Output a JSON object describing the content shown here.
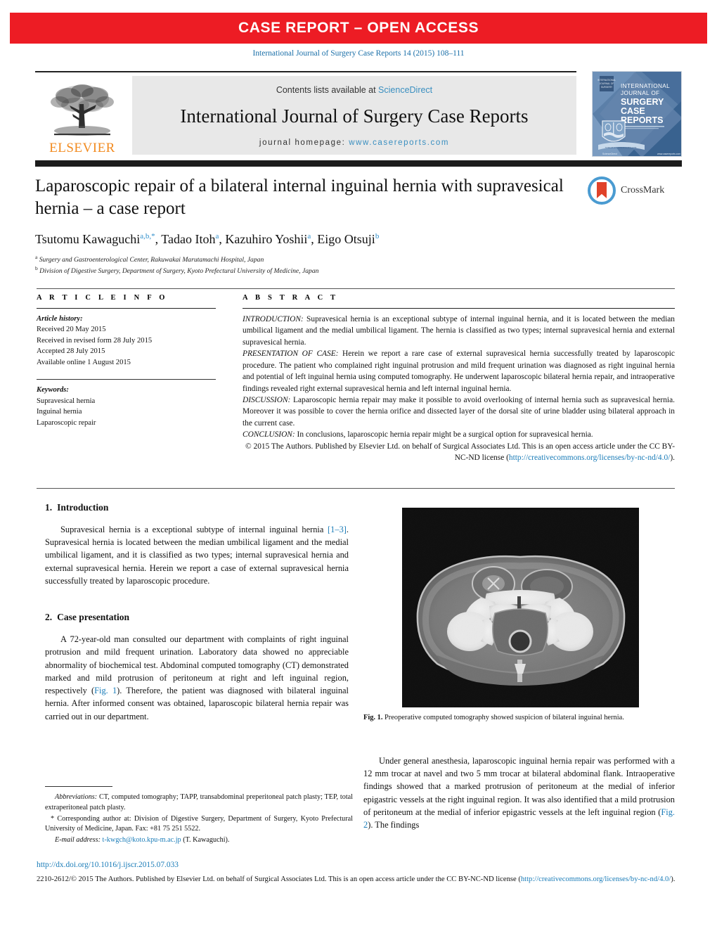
{
  "banner": {
    "text": "CASE REPORT – OPEN ACCESS"
  },
  "citation": "International Journal of Surgery Case Reports 14 (2015) 108–111",
  "masthead": {
    "publisher": "ELSEVIER",
    "contents_prefix": "Contents lists available at ",
    "contents_link": "ScienceDirect",
    "journal_name": "International Journal of Surgery Case Reports",
    "homepage_prefix": "journal homepage: ",
    "homepage_url": "www.casereports.com",
    "cover_lines": [
      "INTERNATIONAL",
      "JOURNAL OF",
      "SURGERY",
      "CASE",
      "REPORTS"
    ],
    "cover_badge": "ELSEVIER"
  },
  "crossmark": {
    "label": "CrossMark"
  },
  "article": {
    "title": "Laparoscopic repair of a bilateral internal inguinal hernia with supravesical hernia – a case report",
    "authors_html": "Tsutomu Kawaguchi<sup>a,b,</sup><sup>*</sup>, Tadao Itoh<sup>a</sup>, Kazuhiro Yoshii<sup>a</sup>, Eigo Otsuji<sup>b</sup>",
    "affiliation_a": "Surgery and Gastroenterological Center, Rakuwakai Marutamachi Hospital, Japan",
    "affiliation_b": "Division of Digestive Surgery, Department of Surgery, Kyoto Prefectural University of Medicine, Japan"
  },
  "info": {
    "heading": "A R T I C L E    I N F O",
    "history_label": "Article history:",
    "history": [
      "Received 20 May 2015",
      "Received in revised form 28 July 2015",
      "Accepted 28 July 2015",
      "Available online 1 August 2015"
    ],
    "keywords_label": "Keywords:",
    "keywords": [
      "Supravesical hernia",
      "Inguinal hernia",
      "Laparoscopic repair"
    ]
  },
  "abstract": {
    "heading": "A B S T R A C T",
    "introduction_tag": "INTRODUCTION:",
    "introduction_text": " Supravesical hernia is an exceptional subtype of internal inguinal hernia, and it is located between the median umbilical ligament and the medial umbilical ligament. The hernia is classified as two types; internal supravesical hernia and external supravesical hernia.",
    "presentation_tag": "PRESENTATION OF CASE:",
    "presentation_text": " Herein we report a rare case of external supravesical hernia successfully treated by laparoscopic procedure. The patient who complained right inguinal protrusion and mild frequent urination was diagnosed as right inguinal hernia and potential of left inguinal hernia using computed tomography. He underwent laparoscopic bilateral hernia repair, and intraoperative findings revealed right external supravesical hernia and left internal inguinal hernia.",
    "discussion_tag": "DISCUSSION:",
    "discussion_text": " Laparoscopic hernia repair may make it possible to avoid overlooking of internal hernia such as supravesical hernia. Moreover it was possible to cover the hernia orifice and dissected layer of the dorsal site of urine bladder using bilateral approach in the current case.",
    "conclusion_tag": "CONCLUSION:",
    "conclusion_text": " In conclusions, laparoscopic hernia repair might be a surgical option for supravesical hernia.",
    "copyright_pre": "© 2015 The Authors. Published by Elsevier Ltd. on behalf of Surgical Associates Ltd. This is an open access article under the CC BY-NC-ND license (",
    "copyright_link": "http://creativecommons.org/licenses/by-nc-nd/4.0/",
    "copyright_post": ")."
  },
  "body": {
    "intro_num": "1.",
    "intro_title": "Introduction",
    "intro_p1_a": "Supravesical hernia is a exceptional subtype of internal inguinal hernia ",
    "intro_ref": "[1–3]",
    "intro_p1_b": ". Supravesical hernia is located between the median umbilical ligament and the medial umbilical ligament, and it is classified as two types; internal supravesical hernia and external supravesical hernia. Herein we report a case of external supravesical hernia successfully treated by laparoscopic procedure.",
    "case_num": "2.",
    "case_title": "Case presentation",
    "case_p1_a": "A 72-year-old man consulted our department with complaints of right inguinal protrusion and mild frequent urination. Laboratory data showed no appreciable abnormality of biochemical test. Abdominal computed tomography (CT) demonstrated marked and mild protrusion of peritoneum at right and left inguinal region, respectively (",
    "case_ref": "Fig. 1",
    "case_p1_b": "). Therefore, the patient was diagnosed with bilateral inguinal hernia. After informed consent was obtained, laparoscopic bilateral hernia repair was carried out in our department.",
    "right_p1_a": "Under general anesthesia, laparoscopic inguinal hernia repair was performed with a 12 mm trocar at navel and two 5 mm trocar at bilateral abdominal flank. Intraoperative findings showed that a marked protrusion of peritoneum at the medial of inferior epigastric vessels at the right inguinal region. It was also identified that a mild protrusion of peritoneum at the medial of inferior epigastric vessels at the left inguinal region (",
    "right_ref": "Fig. 2",
    "right_p1_b": "). The findings"
  },
  "figure": {
    "label": "Fig. 1.",
    "caption": " Preoperative computed tomography showed suspicion of bilateral inguinal hernia."
  },
  "footnotes": {
    "abbrev_label": "Abbreviations:",
    "abbrev_text": " CT, computed tomography; TAPP, transabdominal preperitoneal patch plasty; TEP, total extraperitoneal patch plasty.",
    "corresponding": "* Corresponding author at: Division of Digestive Surgery, Department of Surgery, Kyoto Prefectural University of Medicine, Japan. Fax: +81 75 251 5522.",
    "email_label": "E-mail address:",
    "email": "t-kwgch@koto.kpu-m.ac.jp",
    "email_attrib": " (T. Kawaguchi)."
  },
  "footer": {
    "doi": "http://dx.doi.org/10.1016/j.ijscr.2015.07.033",
    "issn_pre": "2210-2612/© 2015 The Authors. Published by Elsevier Ltd. on behalf of Surgical Associates Ltd. This is an open access article under the CC BY-NC-ND license (",
    "issn_link": "http://creativecommons.org/licenses/by-nc-nd/4.0/",
    "issn_post": ")."
  },
  "colors": {
    "banner_red": "#ED1C24",
    "link_blue": "#1a7cb8",
    "elsevier_orange": "#F28B20"
  }
}
